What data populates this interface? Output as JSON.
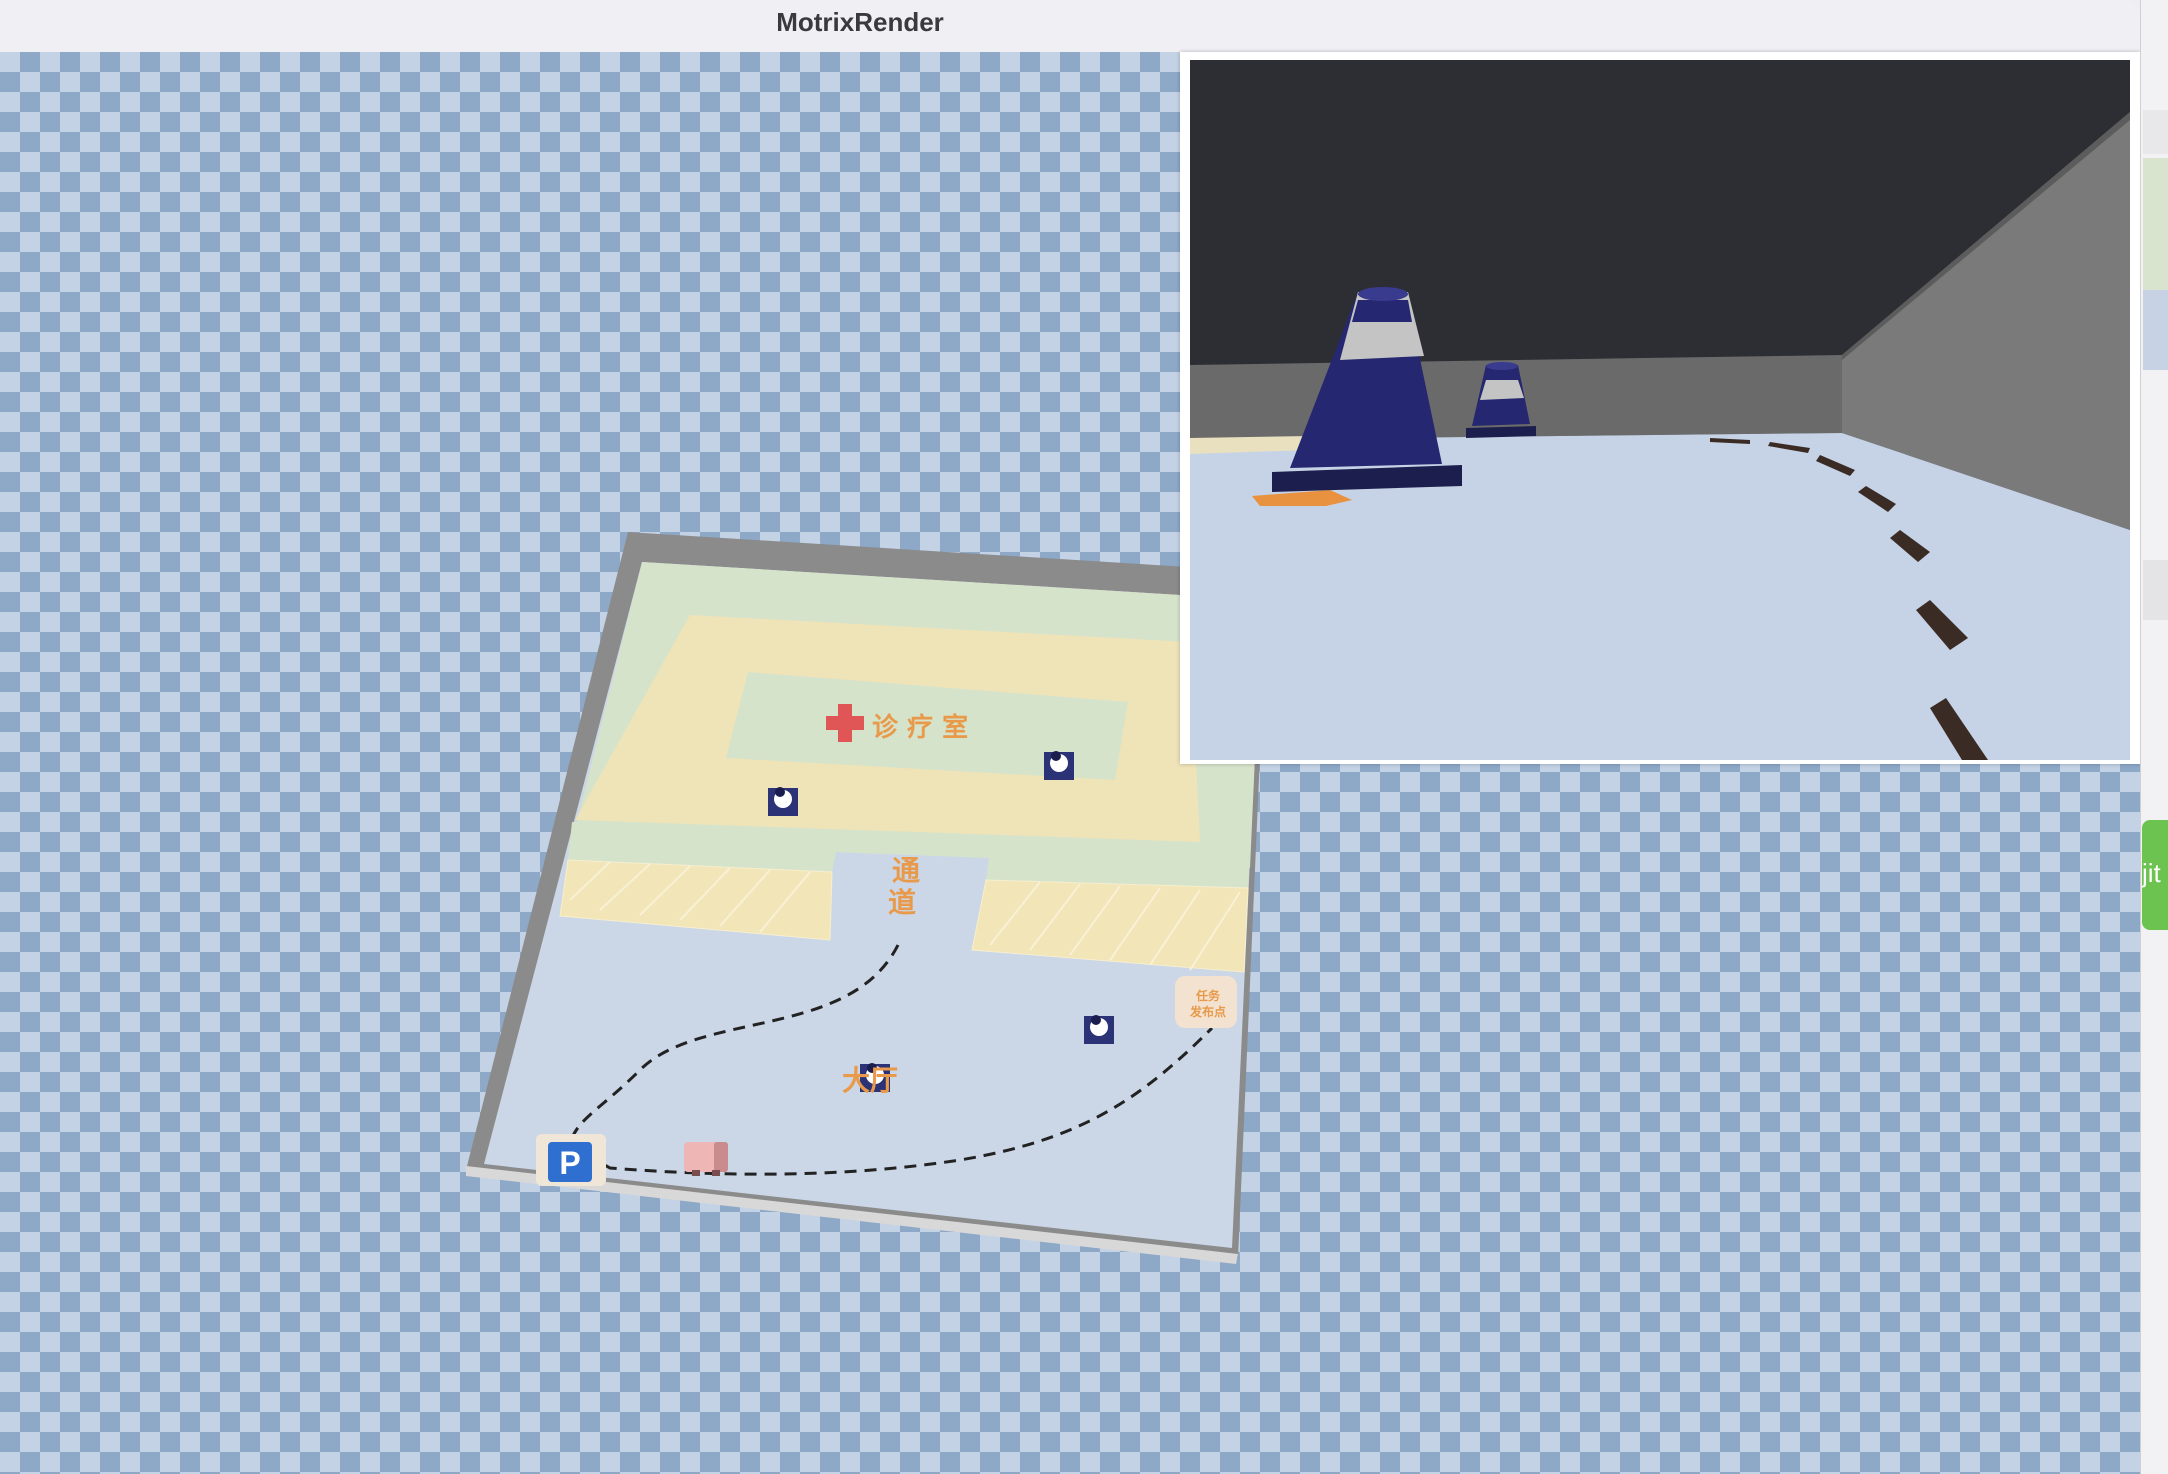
{
  "window": {
    "title": "MotrixRender"
  },
  "map": {
    "clinic_label": "诊 疗 室",
    "corridor_label_top": "通",
    "corridor_label_bottom": "道",
    "task_point_label_line1": "任务",
    "task_point_label_line2": "发布点",
    "hall_label": "大厅",
    "parking_label": "P"
  },
  "sidebar": {
    "commit_label": "jit"
  },
  "icons": {
    "clinic": "red-cross-icon",
    "parking": "parking-sign-icon",
    "robot": "robot-car-icon",
    "cone": "traffic-cone-icon"
  },
  "colors": {
    "floor_checker_dark": "#8ea8c8",
    "floor_checker_light": "#c3d2e5",
    "arena_wall": "#8a8a8a",
    "clinic_zone": "#d6e3cb",
    "corridor_zone": "#efe3b8",
    "hall_zone": "#cbd7e6",
    "label_orange": "#e89a4a",
    "cone_blue": "#232566",
    "commit_green": "#6cc34f"
  }
}
